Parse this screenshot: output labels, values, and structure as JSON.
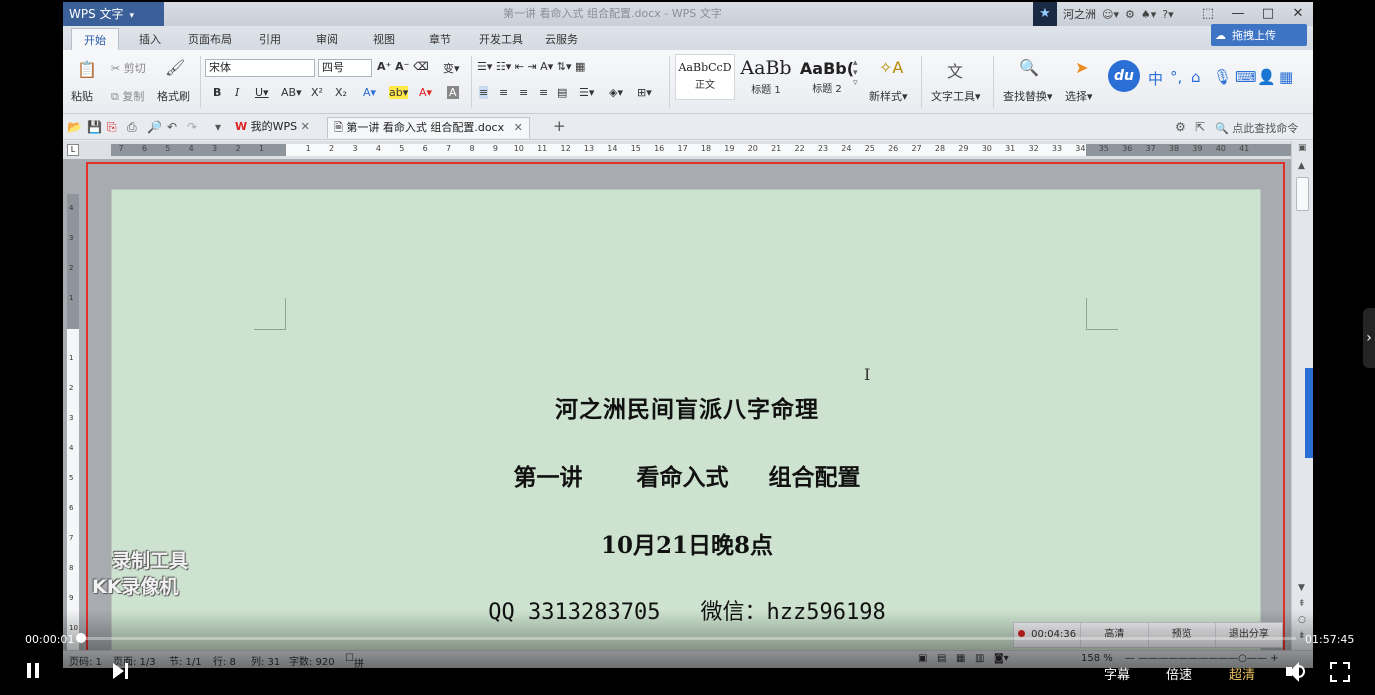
{
  "window": {
    "app_name": "WPS 文字",
    "title": "第一讲   看命入式  组合配置.docx - WPS 文字",
    "user": "河之洲",
    "upload_label": "拖拽上传",
    "controls": [
      "—",
      "□",
      "✕"
    ]
  },
  "tabs": [
    {
      "label": "开始",
      "active": true
    },
    {
      "label": "插入"
    },
    {
      "label": "页面布局"
    },
    {
      "label": "引用"
    },
    {
      "label": "审阅"
    },
    {
      "label": "视图"
    },
    {
      "label": "章节"
    },
    {
      "label": "开发工具"
    },
    {
      "label": "云服务"
    }
  ],
  "ribbon": {
    "paste": "粘贴",
    "cut": "剪切",
    "copy": "复制",
    "format_painter": "格式刷",
    "font_name": "宋体",
    "font_size": "四号",
    "styles": [
      {
        "sample": "AaBbCcD",
        "name": "正文"
      },
      {
        "sample": "AaBb",
        "name": "标题 1"
      },
      {
        "sample": "AaBb(",
        "name": "标题 2"
      }
    ],
    "new_style": "新样式",
    "text_tools": "文字工具",
    "find_replace": "查找替换",
    "select": "选择",
    "du": "du",
    "ime": "中"
  },
  "quickbar": {
    "tab_mywps": "我的WPS",
    "tab_doc": "第一讲   看命入式  组合配置.docx",
    "find_command": "点此查找命令"
  },
  "ruler": {
    "numbers": [
      "7",
      "6",
      "5",
      "4",
      "3",
      "2",
      "1",
      "",
      "1",
      "2",
      "3",
      "4",
      "5",
      "6",
      "7",
      "8",
      "9",
      "10",
      "11",
      "12",
      "13",
      "14",
      "15",
      "16",
      "17",
      "18",
      "19",
      "20",
      "21",
      "22",
      "23",
      "24",
      "25",
      "26",
      "27",
      "28",
      "29",
      "30",
      "31",
      "32",
      "33",
      "34",
      "35",
      "36",
      "37",
      "38",
      "39",
      "40",
      "41"
    ],
    "vertical_numbers": [
      "4",
      "3",
      "2",
      "1",
      "",
      "1",
      "2",
      "3",
      "4",
      "5",
      "6",
      "7",
      "8",
      "9",
      "10"
    ]
  },
  "document": {
    "line1": "河之洲民间盲派八字命理",
    "line2_parts": [
      "第一讲",
      "看命入式",
      "组合配置"
    ],
    "line3": "10月21日晚8点",
    "contact_qq": "QQ 3313283705",
    "contact_wechat": "微信：hzz596198",
    "ibeam": "I"
  },
  "statusbar": {
    "page": "页码: 1",
    "pages": "页面: 1/3",
    "section": "节: 1/1",
    "row": "行: 8",
    "col": "列: 31",
    "words": "字数: 920",
    "spellcheck": "拼写检查",
    "zoom": "158 %"
  },
  "recorder": {
    "time": "00:04:36",
    "hd": "高清",
    "preview": "预览",
    "exit": "退出分享"
  },
  "watermark": {
    "line1": "录制工具",
    "line2": "KK录像机"
  },
  "player": {
    "current_time": "00:00:01",
    "total_time": "01:57:45",
    "progress": 0.0001,
    "subtitle": "字幕",
    "speed": "倍速",
    "quality": "超清",
    "accent": "#e8c060"
  }
}
